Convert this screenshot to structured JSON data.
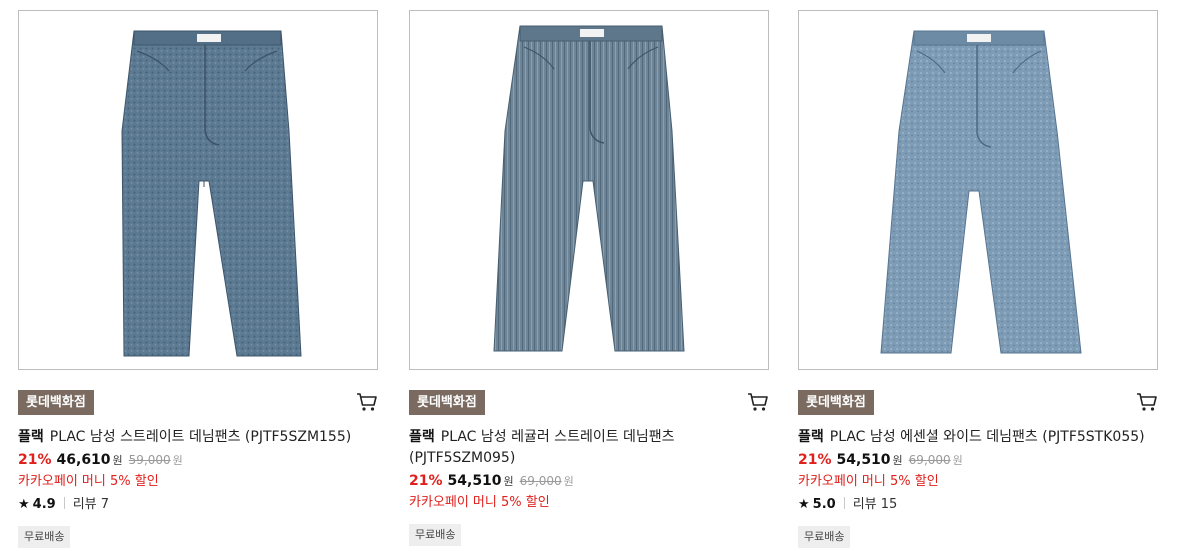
{
  "products": [
    {
      "store_badge": "롯데백화점",
      "brand": "플랙",
      "name": "PLAC 남성 스트레이트 데님팬츠 (PJTF5SZM155)",
      "discount": "21%",
      "sale_price": "46,610",
      "currency": "원",
      "original_price": "59,000",
      "promo": "카카오페이 머니 5% 할인",
      "rating_score": "4.9",
      "review_label": "리뷰 7",
      "shipping_tag": "무료배송",
      "image_icon": "jeans-image",
      "denim_color": "#5d7a93"
    },
    {
      "store_badge": "롯데백화점",
      "brand": "플랙",
      "name": "PLAC 남성 레귤러 스트레이트 데님팬츠 (PJTF5SZM095)",
      "discount": "21%",
      "sale_price": "54,510",
      "currency": "원",
      "original_price": "69,000",
      "promo": "카카오페이 머니 5% 할인",
      "shipping_tag": "무료배송",
      "image_icon": "jeans-image",
      "denim_color": "#6d8597"
    },
    {
      "store_badge": "롯데백화점",
      "brand": "플랙",
      "name": "PLAC 남성 에센셜 와이드 데님팬츠 (PJTF5STK055)",
      "discount": "21%",
      "sale_price": "54,510",
      "currency": "원",
      "original_price": "69,000",
      "promo": "카카오페이 머니 5% 할인",
      "rating_score": "5.0",
      "review_label": "리뷰 15",
      "shipping_tag": "무료배송",
      "image_icon": "jeans-image",
      "denim_color": "#7e9cb5"
    }
  ],
  "icons": {
    "cart": "cart-icon",
    "star": "star-icon"
  },
  "colors": {
    "discount_red": "#e0201c",
    "badge_brown": "#7a6a60"
  }
}
